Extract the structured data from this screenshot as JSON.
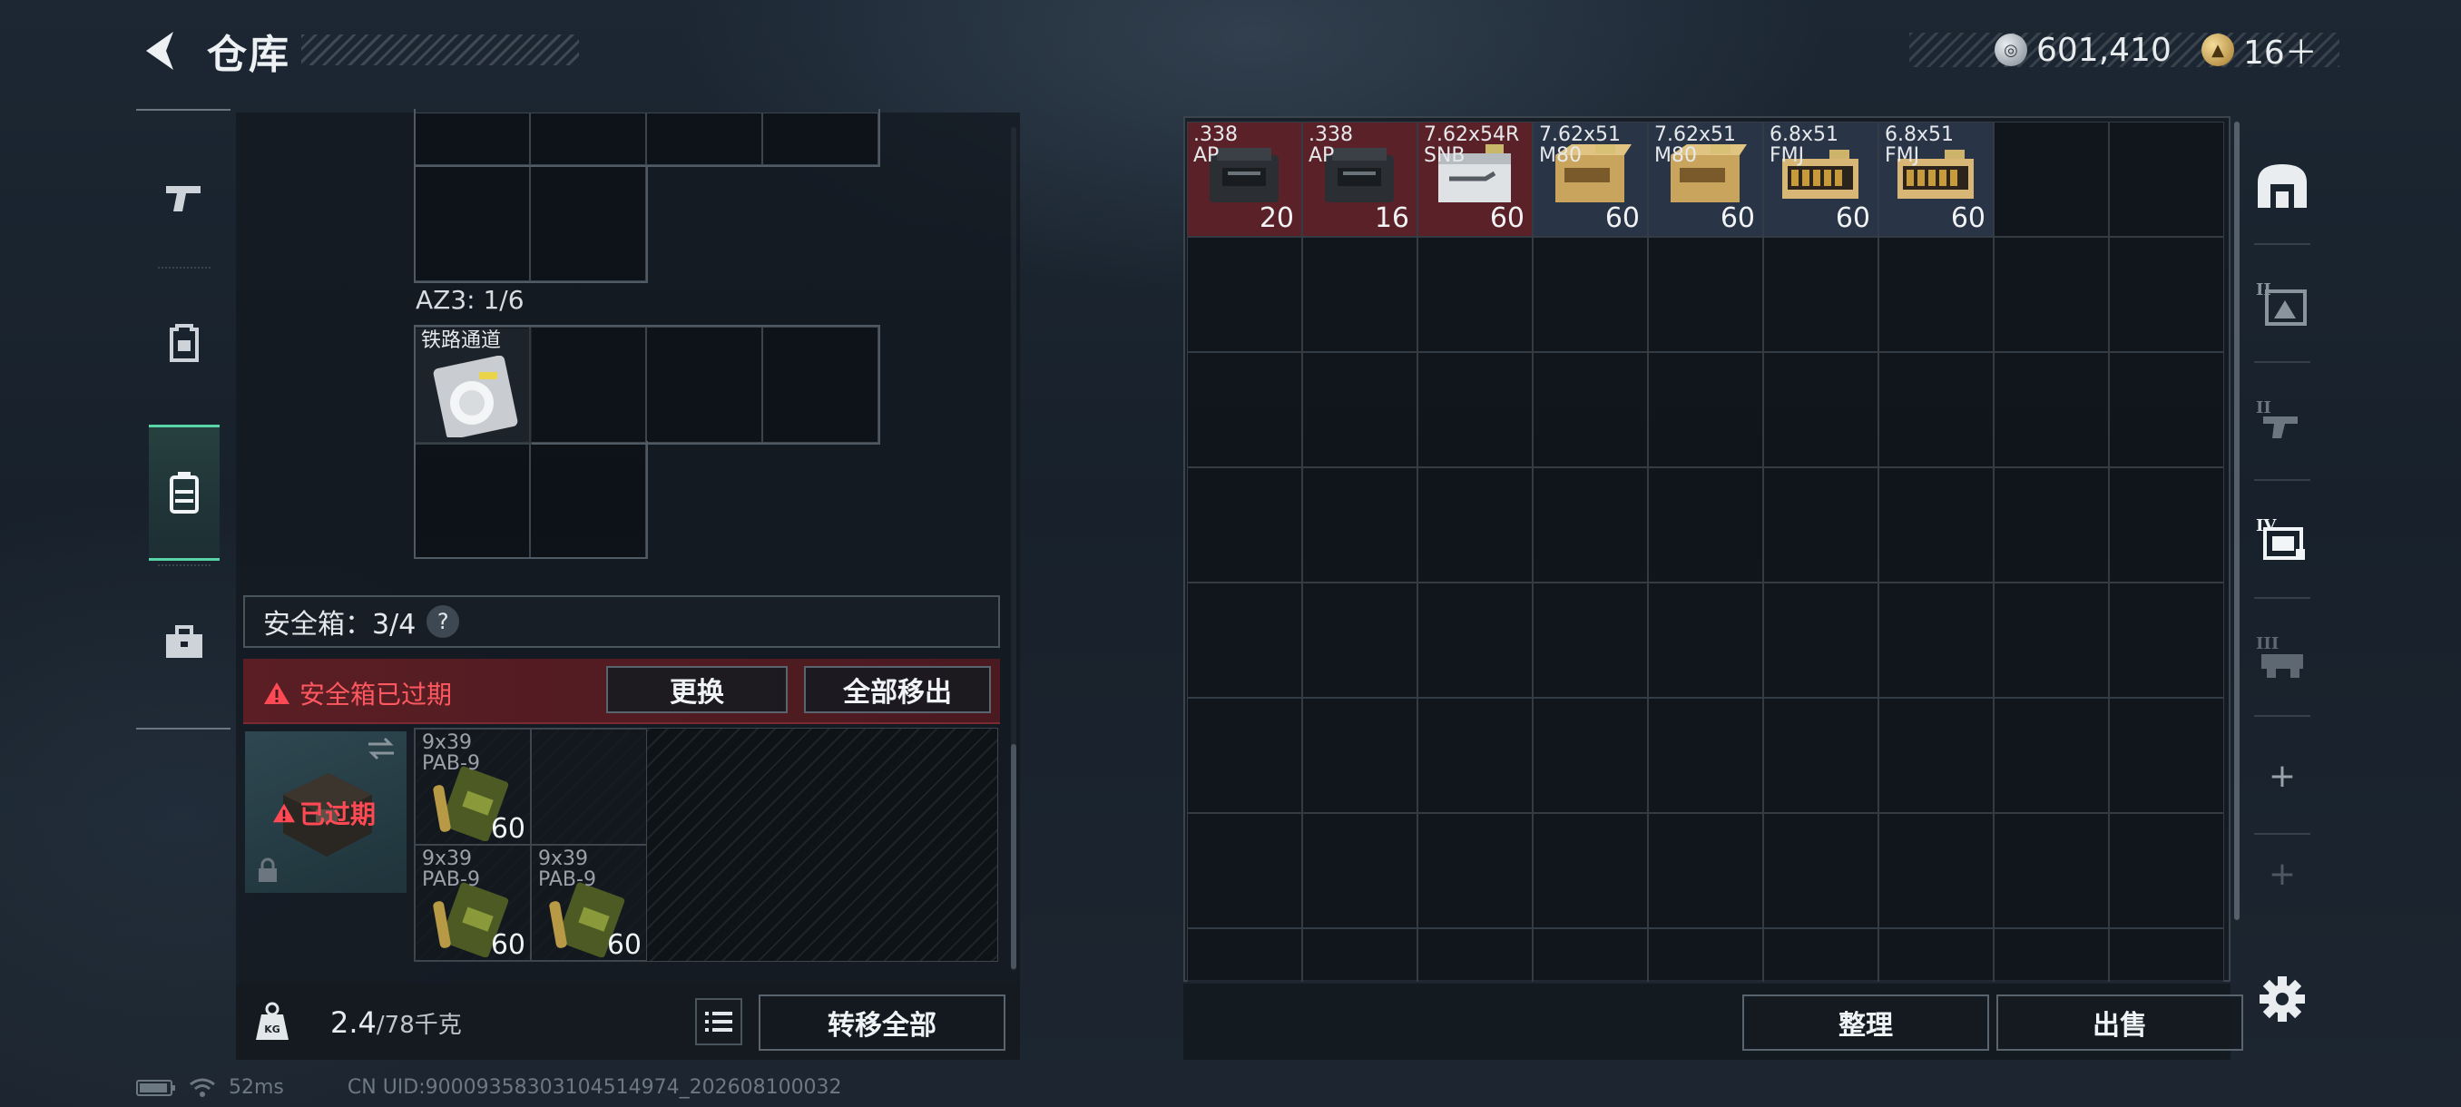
{
  "header": {
    "title": "仓库",
    "currency_primary": "601,410",
    "currency_secondary": "16＋"
  },
  "left_tabs": [
    {
      "icon": "pistol-icon"
    },
    {
      "icon": "backpack-icon"
    },
    {
      "icon": "safe-case-icon",
      "active": true
    },
    {
      "icon": "toolbox-icon"
    }
  ],
  "container": {
    "az3_label": "AZ3: 1/6",
    "railway_item": {
      "name": "铁路通道"
    }
  },
  "safebox": {
    "label": "安全箱：3/4",
    "help": "?",
    "warning": "安全箱已过期",
    "replace_button": "更换",
    "move_all_button": "全部移出",
    "expired_label": "已过期",
    "items": [
      {
        "name": "9x39\nPAB-9",
        "count": "60"
      },
      {
        "name": "9x39\nPAB-9",
        "count": "60"
      },
      {
        "name": "9x39\nPAB-9",
        "count": "60"
      }
    ]
  },
  "weight": {
    "current": "2.4",
    "max": "/78千克"
  },
  "transfer_all_button": "转移全部",
  "storage": {
    "items": [
      {
        "name": ".338\nAP",
        "count": "20",
        "highlight": "#5a2228",
        "art": "ammo-case-dark"
      },
      {
        "name": ".338\nAP",
        "count": "16",
        "highlight": "#5a2228",
        "art": "ammo-case-dark"
      },
      {
        "name": "7.62x54R\nSNB",
        "count": "60",
        "highlight": "#5a2228",
        "art": "ammo-box-white"
      },
      {
        "name": "7.62x51\nM80",
        "count": "60",
        "highlight": "#2a3447",
        "art": "ammo-box-tan"
      },
      {
        "name": "7.62x51\nM80",
        "count": "60",
        "highlight": "#2a3447",
        "art": "ammo-box-tan"
      },
      {
        "name": "6.8x51\nFMJ",
        "count": "60",
        "highlight": "#2a3447",
        "art": "ammo-box-rounds"
      },
      {
        "name": "6.8x51\nFMJ",
        "count": "60",
        "highlight": "#2a3447",
        "art": "ammo-box-rounds"
      }
    ],
    "sort_button": "整理",
    "sell_button": "出售"
  },
  "side_tabs": [
    {
      "icon": "storage-main-icon"
    },
    {
      "icon": "storage-ii-icon"
    },
    {
      "icon": "storage-ii-b-icon"
    },
    {
      "icon": "storage-iv-icon"
    },
    {
      "icon": "storage-iii-icon"
    },
    {
      "icon": "add-storage-icon"
    },
    {
      "icon": "add-storage-icon"
    }
  ],
  "status": {
    "ping": "52ms",
    "uid": "CN UID:90009358303104514974_202608100032"
  }
}
